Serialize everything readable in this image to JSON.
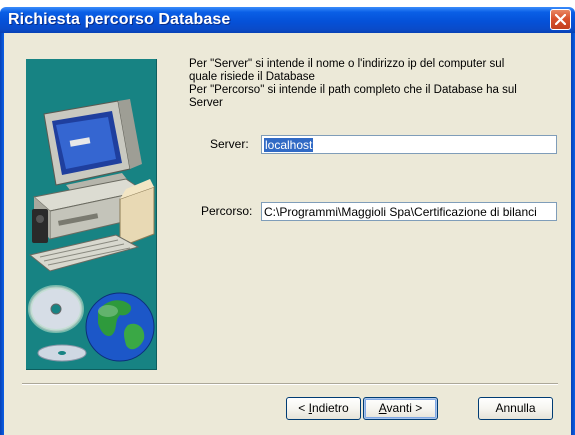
{
  "window": {
    "title": "Richiesta percorso Database"
  },
  "description": {
    "line1": "Per \"Server\" si intende il nome o l'indirizzo ip del computer sul",
    "line2": "quale risiede il Database",
    "line3": "Per \"Percorso\" si intende il path completo che il Database ha sul",
    "line4": "Server"
  },
  "server": {
    "label": "Server:",
    "value": "localhost"
  },
  "percorso": {
    "label": "Percorso:",
    "value": "C:\\Programmi\\Maggioli Spa\\Certificazione di bilanci"
  },
  "buttons": {
    "back": {
      "mnemonic": "I",
      "rest": "ndietro",
      "prefix": "< "
    },
    "next": {
      "mnemonic": "A",
      "rest": "vanti",
      "suffix": " >"
    },
    "cancel": "Annulla"
  },
  "icons": {
    "close": "close-icon",
    "illustration": "computer-globe-illustration"
  },
  "colors": {
    "titlebar": "#0551d8",
    "client": "#ece9d8",
    "bitmap_bg": "#178383",
    "selection": "#316ac5"
  }
}
